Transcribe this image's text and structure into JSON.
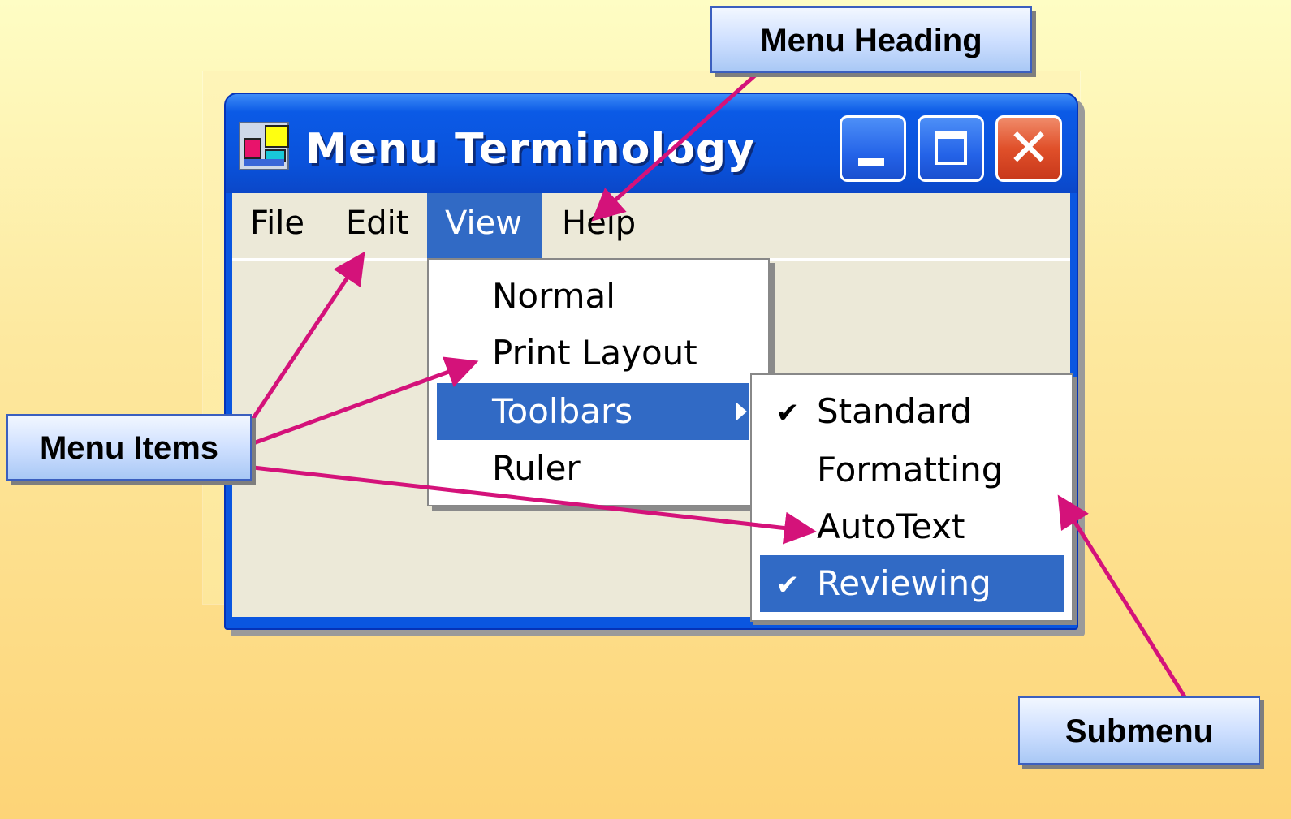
{
  "window": {
    "title": "Menu Terminology",
    "controls": {
      "minimize_icon": "minimize-icon",
      "maximize_icon": "maximize-icon",
      "close_icon": "close-icon",
      "close_glyph": "✕"
    }
  },
  "menubar": {
    "items": [
      {
        "label": "File"
      },
      {
        "label": "Edit"
      },
      {
        "label": "View",
        "active": true
      },
      {
        "label": "Help"
      }
    ]
  },
  "view_menu": {
    "items": [
      {
        "label": "Normal"
      },
      {
        "label": "Print Layout"
      },
      {
        "label": "Toolbars",
        "highlighted": true,
        "has_submenu": true
      },
      {
        "label": "Ruler"
      }
    ]
  },
  "toolbars_submenu": {
    "items": [
      {
        "label": "Standard",
        "checked": true
      },
      {
        "label": "Formatting",
        "checked": false
      },
      {
        "label": "AutoText",
        "checked": false
      },
      {
        "label": "Reviewing",
        "checked": true,
        "highlighted": true
      }
    ],
    "check_glyph": "✔"
  },
  "callouts": {
    "menu_heading": "Menu Heading",
    "menu_items": "Menu Items",
    "submenu": "Submenu"
  },
  "colors": {
    "arrow": "#d4127a",
    "highlight": "#316ac5",
    "titlebar": "#0a52db",
    "menu_background": "#ece9d8"
  }
}
